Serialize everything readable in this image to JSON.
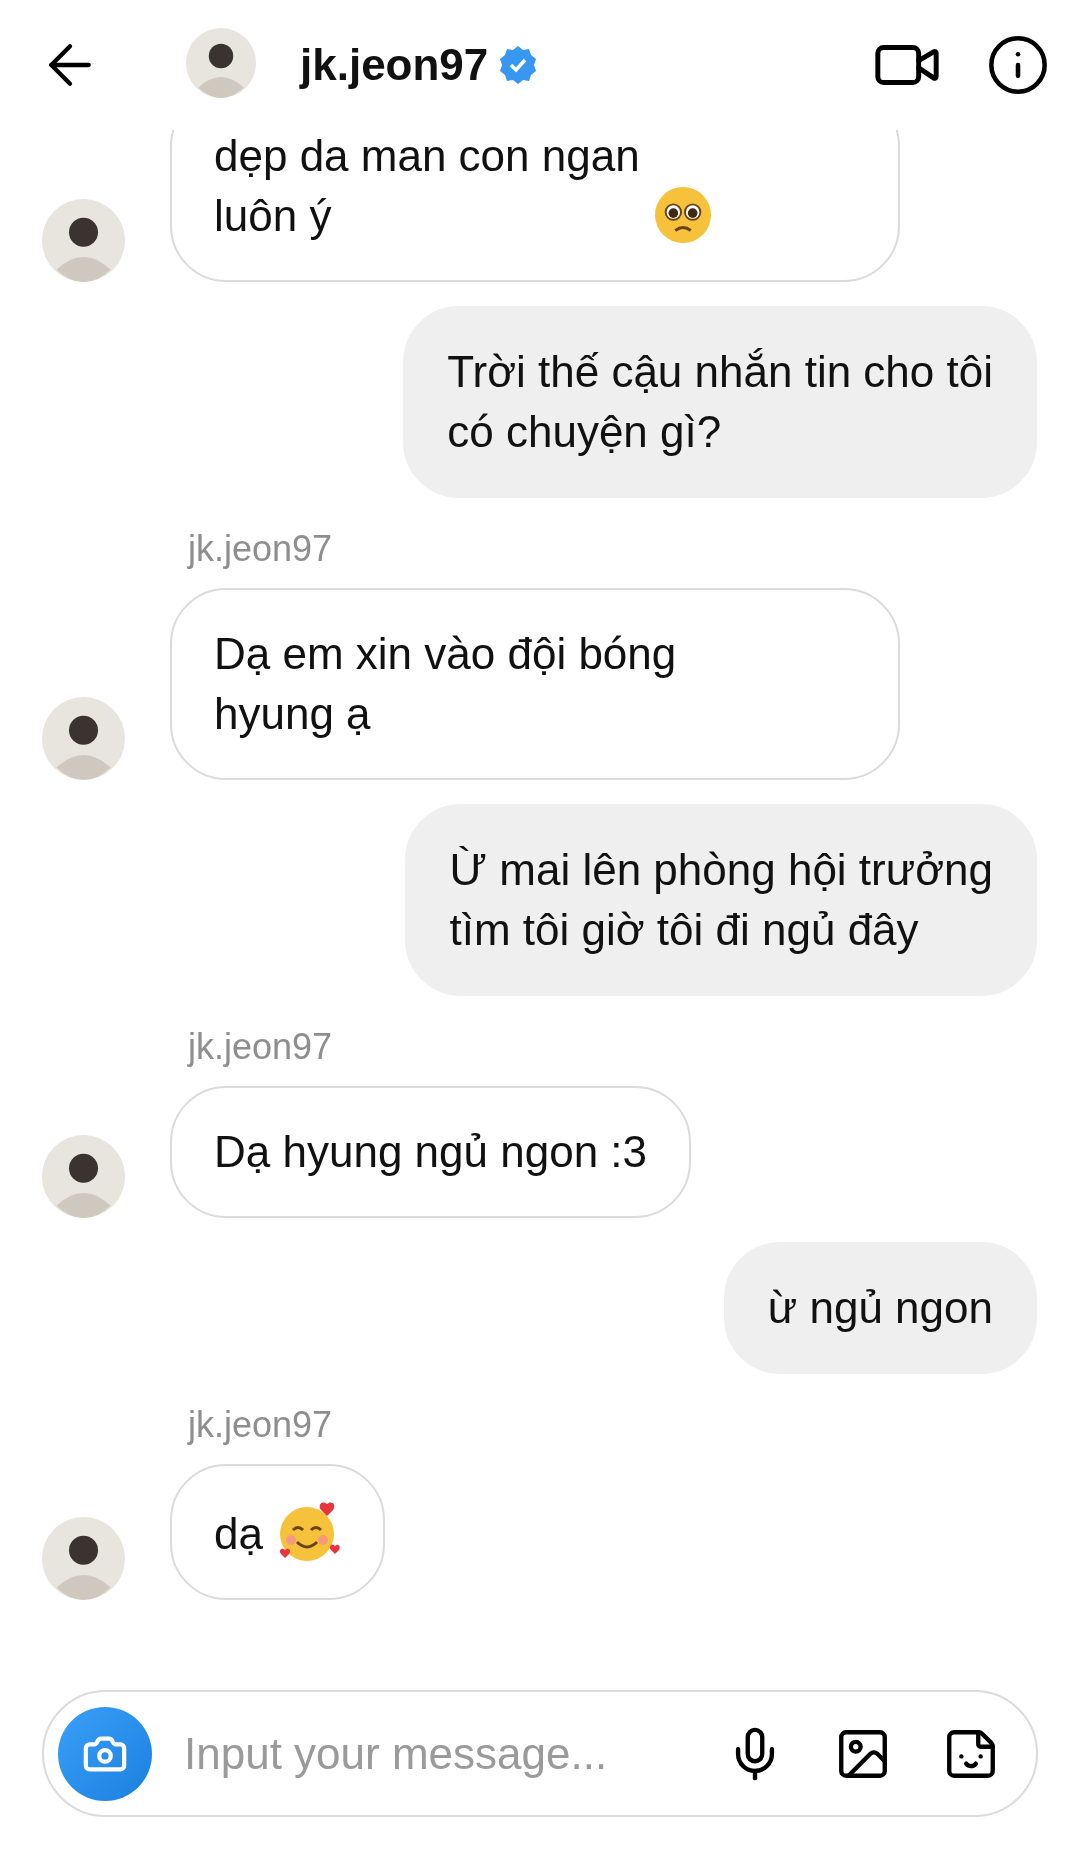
{
  "header": {
    "username": "jk.jeon97",
    "verified": true
  },
  "messages": [
    {
      "kind": "incoming",
      "text": "dẹp da man con ngan\nluôn ý",
      "emoji": {
        "kind": "pleading"
      }
    },
    {
      "kind": "outgoing",
      "text": "Trời thế cậu nhắn tin cho tôi\ncó chuyện gì?"
    },
    {
      "kind": "incoming",
      "sender": "jk.jeon97",
      "text": "Dạ em xin vào đội bóng\nhyung ạ"
    },
    {
      "kind": "outgoing",
      "text": "Ừ mai lên phòng hội trưởng\ntìm tôi giờ tôi đi ngủ đây"
    },
    {
      "kind": "incoming",
      "sender": "jk.jeon97",
      "text": "Dạ hyung ngủ ngon :3"
    },
    {
      "kind": "outgoing",
      "text": "ừ ngủ ngon"
    },
    {
      "kind": "incoming",
      "sender": "jk.jeon97",
      "text": "dạ",
      "emoji": {
        "kind": "hearts"
      }
    }
  ],
  "composer": {
    "placeholder": "Input your message..."
  }
}
